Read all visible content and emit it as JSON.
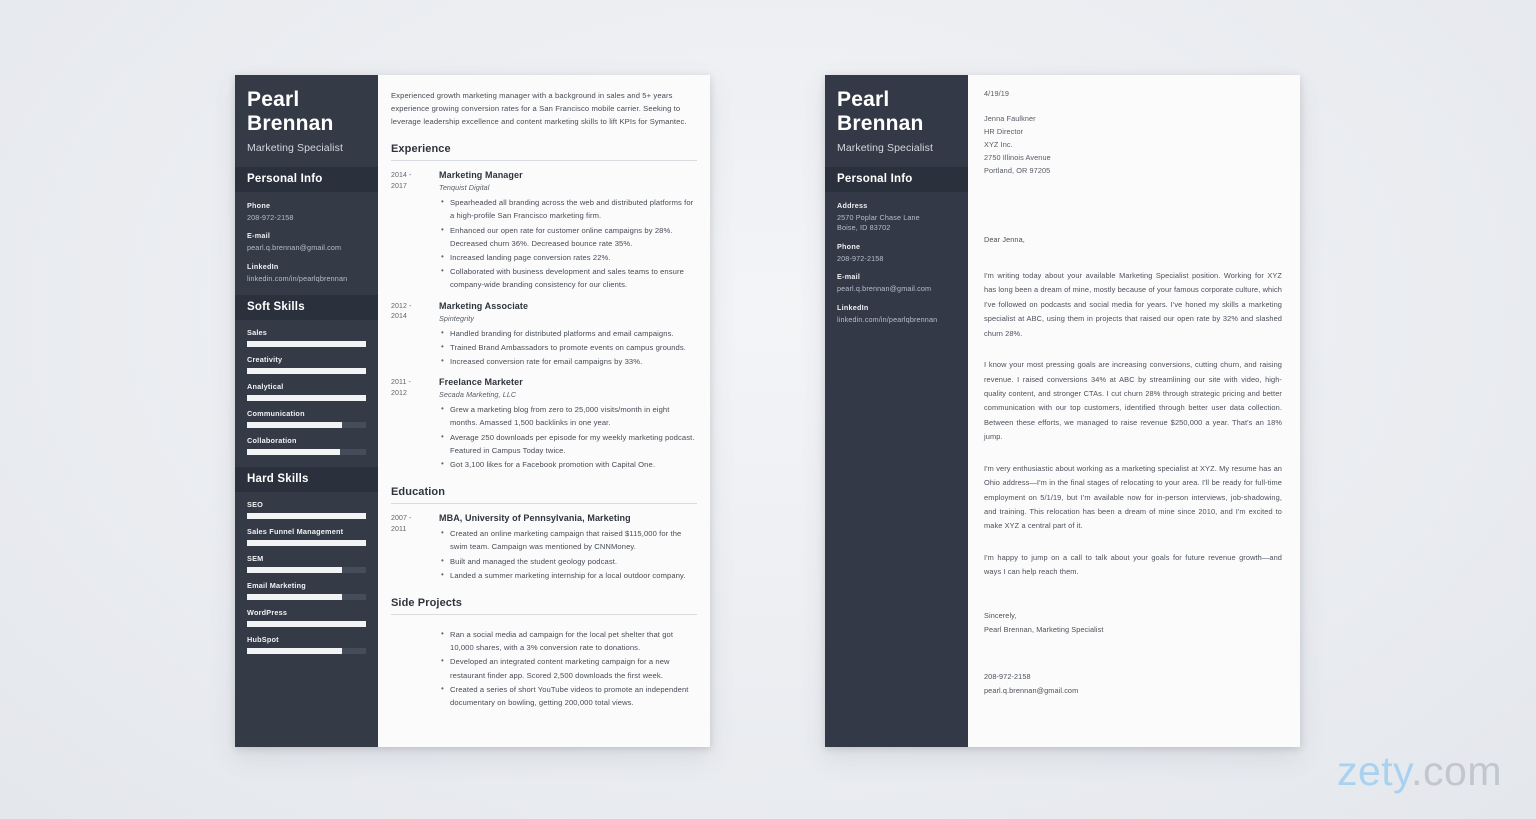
{
  "background_color": "#eceef2",
  "accent_colors": {
    "sidebar_dark": "#343a46",
    "sidebar_header_dark": "#2b313c",
    "skill_bar_fill": "#f2f3f5",
    "skill_bar_track": "#454c5a",
    "logo_blue": "#a8d2f0",
    "logo_gray": "#c2c6cd"
  },
  "resume": {
    "name_line1": "Pearl",
    "name_line2": "Brennan",
    "role": "Marketing Specialist",
    "personal_info_heading": "Personal Info",
    "contact": [
      {
        "label": "Phone",
        "value": "208-972-2158"
      },
      {
        "label": "E-mail",
        "value": "pearl.q.brennan@gmail.com"
      },
      {
        "label": "LinkedIn",
        "value": "linkedin.com/in/pearlqbrennan"
      }
    ],
    "soft_skills_heading": "Soft Skills",
    "soft_skills": [
      {
        "name": "Sales",
        "level": 100
      },
      {
        "name": "Creativity",
        "level": 100
      },
      {
        "name": "Analytical",
        "level": 100
      },
      {
        "name": "Communication",
        "level": 80
      },
      {
        "name": "Collaboration",
        "level": 78
      }
    ],
    "hard_skills_heading": "Hard Skills",
    "hard_skills": [
      {
        "name": "SEO",
        "level": 100
      },
      {
        "name": "Sales Funnel Management",
        "level": 100
      },
      {
        "name": "SEM",
        "level": 80
      },
      {
        "name": "Email Marketing",
        "level": 80
      },
      {
        "name": "WordPress",
        "level": 100
      },
      {
        "name": "HubSpot",
        "level": 80
      }
    ],
    "summary": "Experienced growth marketing manager with a background in sales and 5+ years experience growing conversion rates for a San Francisco mobile carrier. Seeking to leverage leadership excellence and content marketing skills to lift KPIs for Symantec.",
    "experience_heading": "Experience",
    "experience": [
      {
        "dates": "2014 - 2017",
        "title": "Marketing Manager",
        "org": "Tenquist Digital",
        "bullets": [
          "Spearheaded all branding across the web and distributed platforms for a high-profile San Francisco marketing firm.",
          "Enhanced our open rate for customer online campaigns by 28%. Decreased churn 36%. Decreased bounce rate 35%.",
          "Increased landing page conversion rates 22%.",
          "Collaborated with business development and sales teams to ensure company-wide branding consistency for our clients."
        ]
      },
      {
        "dates": "2012 - 2014",
        "title": "Marketing Associate",
        "org": "Spintegrity",
        "bullets": [
          "Handled branding for distributed platforms and email campaigns.",
          "Trained Brand Ambassadors to promote events on campus grounds.",
          "Increased conversion rate for email campaigns by 33%."
        ]
      },
      {
        "dates": "2011 - 2012",
        "title": "Freelance Marketer",
        "org": "Secada Marketing, LLC",
        "bullets": [
          "Grew a marketing blog from zero to 25,000 visits/month in eight months. Amassed 1,500 backlinks in one year.",
          "Average 250 downloads per episode for my weekly marketing podcast. Featured in Campus Today twice.",
          "Got 3,100 likes for a Facebook promotion with Capital One."
        ]
      }
    ],
    "education_heading": "Education",
    "education": [
      {
        "dates": "2007 - 2011",
        "title": "MBA, University of Pennsylvania, Marketing",
        "bullets": [
          "Created an online marketing campaign that raised $115,000 for the swim team. Campaign was mentioned by CNNMoney.",
          "Built and managed the student geology podcast.",
          "Landed a summer marketing internship for a local outdoor company."
        ]
      }
    ],
    "side_projects_heading": "Side Projects",
    "side_projects": [
      "Ran a social media ad campaign for the local pet shelter that got 10,000 shares, with a 3% conversion rate to donations.",
      "Developed an integrated content marketing campaign for a new restaurant finder app. Scored 2,500 downloads the first week.",
      "Created a series of short YouTube videos to promote an independent documentary on bowling, getting 200,000 total views."
    ]
  },
  "cover_letter": {
    "name_line1": "Pearl",
    "name_line2": "Brennan",
    "role": "Marketing Specialist",
    "personal_info_heading": "Personal Info",
    "contact": [
      {
        "label": "Address",
        "value": "2570 Poplar Chase Lane\nBoise, ID 83702"
      },
      {
        "label": "Phone",
        "value": "208-972-2158"
      },
      {
        "label": "E-mail",
        "value": "pearl.q.brennan@gmail.com"
      },
      {
        "label": "LinkedIn",
        "value": "linkedin.com/in/pearlqbrennan"
      }
    ],
    "date": "4/19/19",
    "recipient": [
      "Jenna Faulkner",
      "HR Director",
      "XYZ Inc.",
      "2750 Illinois Avenue",
      "Portland, OR 97205"
    ],
    "greeting": "Dear Jenna,",
    "paragraphs": [
      "I'm writing today about your available Marketing Specialist position. Working for XYZ has long been a dream of mine, mostly because of your famous corporate culture, which I've followed on podcasts and social media for years. I've honed my skills a marketing specialist at ABC, using them in projects that raised our open rate by 32% and slashed churn 28%.",
      "I know your most pressing goals are increasing conversions, cutting churn, and raising revenue. I raised conversions 34% at ABC by streamlining our site with video, high-quality content, and stronger CTAs. I cut churn 28% through strategic pricing and better communication with our top customers, identified through better user data collection. Between these efforts, we managed to raise revenue $250,000 a year. That's an 18% jump.",
      "I'm very enthusiastic about working as a marketing specialist at XYZ. My resume has an Ohio address—I'm in the final stages of relocating to your area. I'll be ready for full-time employment on 5/1/19, but I'm available now for in-person interviews, job-shadowing, and training. This relocation has been a dream of mine since 2010, and I'm excited to make XYZ a central part of it.",
      "I'm happy to jump on a call to talk about your goals for future revenue growth—and ways I can help reach them."
    ],
    "closing": "Sincerely,",
    "signature": "Pearl Brennan, Marketing Specialist",
    "footer_contact": [
      "208-972-2158",
      "pearl.q.brennan@gmail.com"
    ]
  },
  "logo": {
    "brand": "zety",
    "tld": ".com"
  }
}
